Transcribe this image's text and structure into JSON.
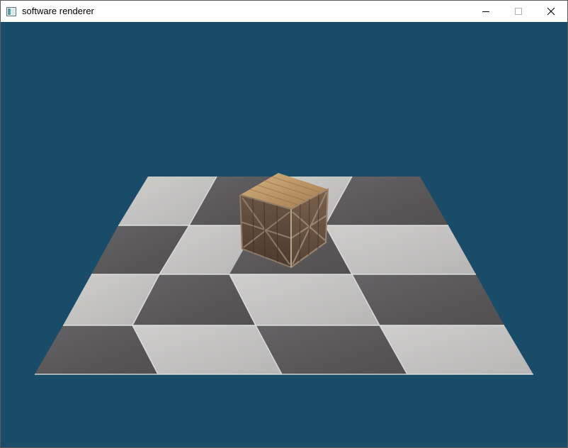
{
  "window": {
    "title": "software renderer",
    "icons": {
      "app": "window-app-icon",
      "minimize": "minimize-icon",
      "maximize": "maximize-icon",
      "close": "close-icon"
    }
  },
  "scene": {
    "background_color": "#194c69",
    "floor": {
      "rows": 4,
      "cols": 4,
      "light_tile_color": "#c4c3c2",
      "dark_tile_color": "#5d5a5c"
    },
    "crate": {
      "top_color": "#c09a6b",
      "front_color": "#5a4535",
      "side_color": "#6a5040"
    }
  }
}
